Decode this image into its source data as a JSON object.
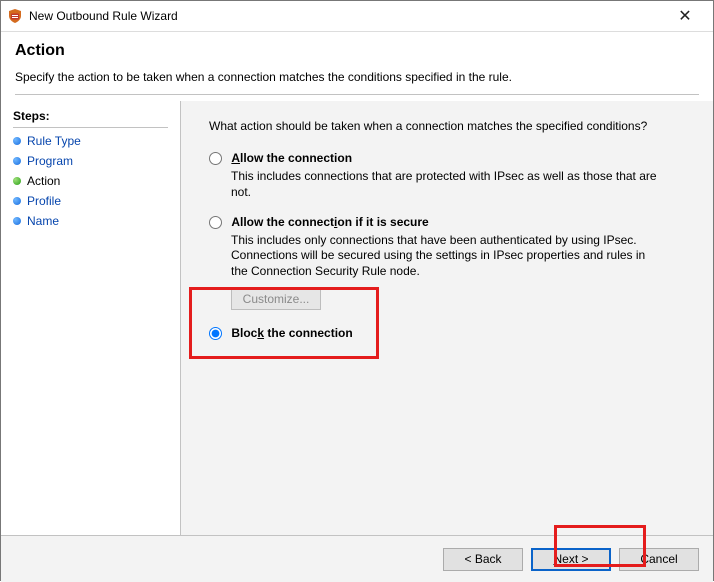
{
  "window": {
    "title": "New Outbound Rule Wizard",
    "close": "✕"
  },
  "header": {
    "title": "Action",
    "subtitle": "Specify the action to be taken when a connection matches the conditions specified in the rule."
  },
  "steps": {
    "label": "Steps:",
    "items": [
      {
        "label": "Rule Type",
        "link": true,
        "current": false
      },
      {
        "label": "Program",
        "link": true,
        "current": false
      },
      {
        "label": "Action",
        "link": false,
        "current": true
      },
      {
        "label": "Profile",
        "link": true,
        "current": false
      },
      {
        "label": "Name",
        "link": true,
        "current": false
      }
    ]
  },
  "main": {
    "question": "What action should be taken when a connection matches the specified conditions?",
    "options": {
      "allow": {
        "label_pre": "A",
        "label_rest": "llow the connection",
        "desc": "This includes connections that are protected with IPsec as well as those that are not."
      },
      "allow_secure": {
        "label_pre": "Allow the connect",
        "label_u": "i",
        "label_post": "on if it is secure",
        "desc": "This includes only connections that have been authenticated by using IPsec.  Connections will be secured using the settings in IPsec properties and rules in the Connection Security Rule node.",
        "customize": "Customize..."
      },
      "block": {
        "label_pre": "Bloc",
        "label_u": "k",
        "label_post": " the connection"
      }
    }
  },
  "footer": {
    "back": "< Back",
    "next": "Next >",
    "cancel": "Cancel"
  }
}
